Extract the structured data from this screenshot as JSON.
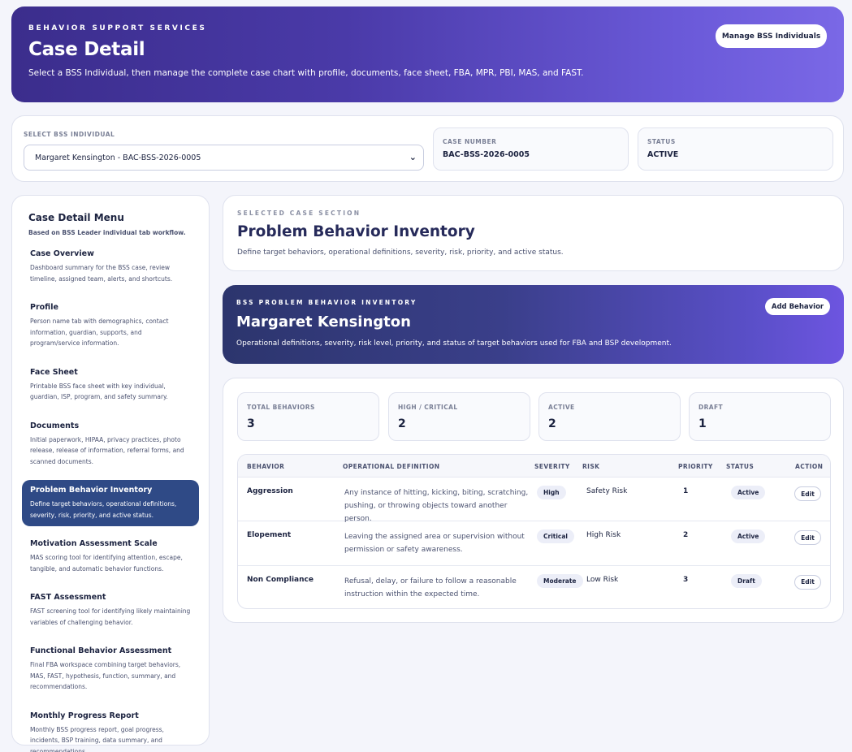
{
  "header": {
    "eyebrow": "BEHAVIOR SUPPORT SERVICES",
    "title": "Case Detail",
    "subtitle": "Select a BSS Individual, then manage the complete case chart with profile, documents, face sheet, FBA, MPR, PBI, MAS, and FAST.",
    "manage_button": "Manage BSS Individuals"
  },
  "selector": {
    "label": "SELECT BSS INDIVIDUAL",
    "selected": "Margaret Kensington - BAC-BSS-2026-0005",
    "case_number_label": "CASE NUMBER",
    "case_number": "BAC-BSS-2026-0005",
    "status_label": "STATUS",
    "status": "ACTIVE"
  },
  "sidebar": {
    "title": "Case Detail Menu",
    "hint": "Based on BSS Leader individual tab workflow.",
    "items": [
      {
        "title": "Case Overview",
        "desc": "Dashboard summary for the BSS case, review timeline, assigned team, alerts, and shortcuts."
      },
      {
        "title": "Profile",
        "desc": "Person name tab with demographics, contact information, guardian, supports, and program/service information."
      },
      {
        "title": "Face Sheet",
        "desc": "Printable BSS face sheet with key individual, guardian, ISP, program, and safety summary."
      },
      {
        "title": "Documents",
        "desc": "Initial paperwork, HIPAA, privacy practices, photo release, release of information, referral forms, and scanned documents."
      },
      {
        "title": "Problem Behavior Inventory",
        "desc": "Define target behaviors, operational definitions, severity, risk, priority, and active status."
      },
      {
        "title": "Motivation Assessment Scale",
        "desc": "MAS scoring tool for identifying attention, escape, tangible, and automatic behavior functions."
      },
      {
        "title": "FAST Assessment",
        "desc": "FAST screening tool for identifying likely maintaining variables of challenging behavior."
      },
      {
        "title": "Functional Behavior Assessment",
        "desc": "Final FBA workspace combining target behaviors, MAS, FAST, hypothesis, function, summary, and recommendations."
      },
      {
        "title": "Monthly Progress Report",
        "desc": "Monthly BSS progress report, goal progress, incidents, BSP training, data summary, and recommendations."
      }
    ]
  },
  "section": {
    "eyebrow": "SELECTED CASE SECTION",
    "title": "Problem Behavior Inventory",
    "subtitle": "Define target behaviors, operational definitions, severity, risk, priority, and active status."
  },
  "inventory": {
    "eyebrow": "BSS PROBLEM BEHAVIOR INVENTORY",
    "name": "Margaret Kensington",
    "subtitle": "Operational definitions, severity, risk level, priority, and status of target behaviors used for FBA and BSP development.",
    "add_button": "Add Behavior"
  },
  "stats": [
    {
      "label": "TOTAL BEHAVIORS",
      "value": "3"
    },
    {
      "label": "HIGH / CRITICAL",
      "value": "2"
    },
    {
      "label": "ACTIVE",
      "value": "2"
    },
    {
      "label": "DRAFT",
      "value": "1"
    }
  ],
  "table": {
    "headers": [
      "BEHAVIOR",
      "OPERATIONAL DEFINITION",
      "SEVERITY",
      "RISK",
      "PRIORITY",
      "STATUS",
      "ACTION"
    ],
    "rows": [
      {
        "behavior": "Aggression",
        "definition": "Any instance of hitting, kicking, biting, scratching, pushing, or throwing objects toward another person.",
        "severity": "High",
        "risk": "Safety Risk",
        "priority": "1",
        "status": "Active",
        "action": "Edit"
      },
      {
        "behavior": "Elopement",
        "definition": "Leaving the assigned area or supervision without permission or safety awareness.",
        "severity": "Critical",
        "risk": "High Risk",
        "priority": "2",
        "status": "Active",
        "action": "Edit"
      },
      {
        "behavior": "Non Compliance",
        "definition": "Refusal, delay, or failure to follow a reasonable instruction within the expected time.",
        "severity": "Moderate",
        "risk": "Low Risk",
        "priority": "3",
        "status": "Draft",
        "action": "Edit"
      }
    ]
  },
  "colors": {
    "active_menu": "#2f4a86",
    "header_gradient_start": "#3b2d8c",
    "header_gradient_end": "#7a68e6",
    "badge_bg": "#eceef8"
  },
  "icons": {
    "select_chevron": "chevron-down-icon"
  }
}
